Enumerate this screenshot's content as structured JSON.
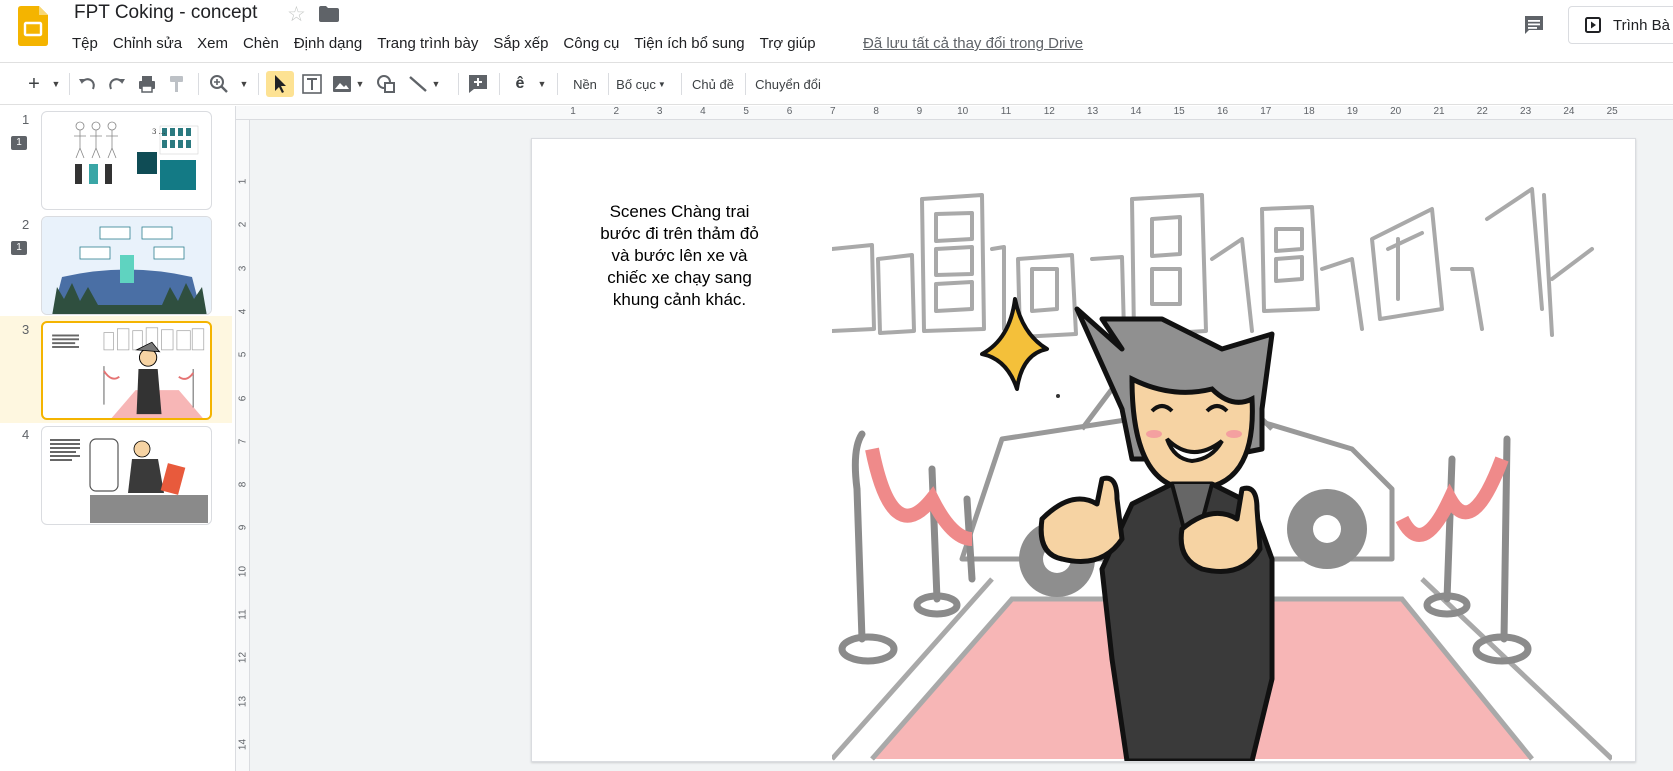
{
  "app": {
    "logo": "slides-logo-icon"
  },
  "document": {
    "title": "FPT Coking - concept",
    "save_status": "Đã lưu tất cả thay đổi trong Drive"
  },
  "menu": [
    "Tệp",
    "Chỉnh sửa",
    "Xem",
    "Chèn",
    "Định dạng",
    "Trang trình bày",
    "Sắp xếp",
    "Công cụ",
    "Tiện ích bổ sung",
    "Trợ giúp"
  ],
  "present_label": "Trình Bà",
  "toolbar": {
    "background_label": "Nền",
    "layout_label": "Bố cục",
    "theme_label": "Chủ đề",
    "transition_label": "Chuyển đổi"
  },
  "slides": [
    {
      "number": "1",
      "comments": "1"
    },
    {
      "number": "2",
      "comments": "1"
    },
    {
      "number": "3",
      "comments": ""
    },
    {
      "number": "4",
      "comments": ""
    }
  ],
  "rulers": {
    "horizontal": [
      "1",
      "2",
      "3",
      "4",
      "5",
      "6",
      "7",
      "8",
      "9",
      "10",
      "11",
      "12",
      "13",
      "14",
      "15",
      "16",
      "17",
      "18",
      "19",
      "20",
      "21",
      "22",
      "23",
      "24",
      "25"
    ],
    "vertical": [
      "1",
      "2",
      "3",
      "4",
      "5",
      "6",
      "7",
      "8",
      "9",
      "10",
      "11",
      "12",
      "13",
      "14"
    ]
  },
  "current_slide": {
    "text": "Scenes Chàng trai\nbước đi trên thảm đỏ\nvà bước lên xe và\nchiếc xe chạy sang\nkhung cảnh khác."
  },
  "colors": {
    "accent": "#f4b400",
    "selected_bg": "#fef7e0",
    "carpet": "#f7b6b6"
  }
}
